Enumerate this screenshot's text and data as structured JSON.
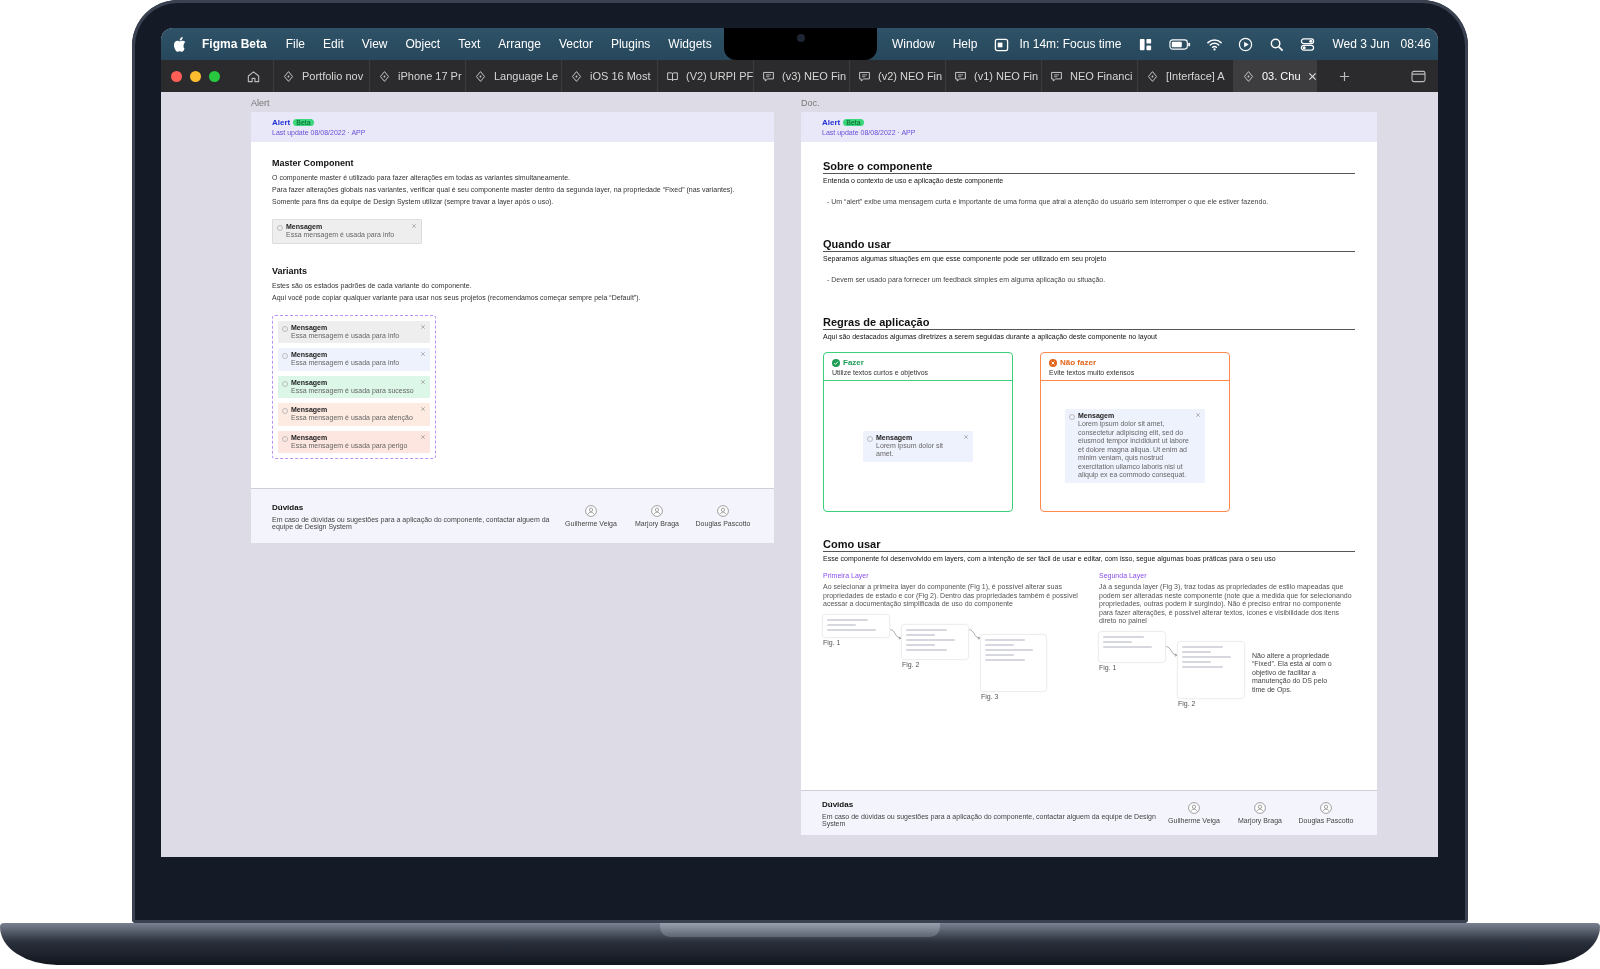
{
  "menu_bar": {
    "app": "Figma Beta",
    "menus_left": [
      "File",
      "Edit",
      "View",
      "Object",
      "Text",
      "Arrange",
      "Vector",
      "Plugins",
      "Widgets"
    ],
    "menus_right": [
      "Window",
      "Help"
    ],
    "focus": "In 14m: Focus time",
    "date": "Wed 3 Jun",
    "time": "08:46"
  },
  "tabs": [
    {
      "label": "Portfolio nov",
      "kind": "design",
      "selected": false
    },
    {
      "label": "iPhone 17 Pr",
      "kind": "design",
      "selected": false
    },
    {
      "label": "Language Le",
      "kind": "design",
      "selected": false
    },
    {
      "label": "iOS 16 Most",
      "kind": "design",
      "selected": false
    },
    {
      "label": "(V2) URPI PF",
      "kind": "slides",
      "selected": false
    },
    {
      "label": "(v3) NEO Fin",
      "kind": "board",
      "selected": false
    },
    {
      "label": "(v2) NEO Fin",
      "kind": "board",
      "selected": false
    },
    {
      "label": "(v1) NEO Fin",
      "kind": "board",
      "selected": false
    },
    {
      "label": "NEO Financi",
      "kind": "board",
      "selected": false
    },
    {
      "label": "[Interface] A",
      "kind": "design",
      "selected": false
    },
    {
      "label": "03. Chu",
      "kind": "design",
      "selected": true
    }
  ],
  "left_frame": {
    "label": "Alert",
    "header": {
      "title": "Alert",
      "badge": "Beta",
      "subtitle": "Last update 08/08/2022 · APP"
    },
    "master": {
      "title": "Master Component",
      "paragraphs": [
        "O componente master é utilizado para fazer alterações em todas as variantes simultaneamente.",
        "Para fazer alterações globais nas variantes, verificar qual é seu componente master dentro da segunda layer, na propriedade  “Fixed” (nas variantes).",
        "Somente para fins da equipe de Design System utilizar (sempre travar a layer após o uso)."
      ],
      "alert": {
        "title": "Mensagem",
        "text": "Essa mensagem é usada para info",
        "color": "#eeeeee"
      }
    },
    "variants": {
      "title": "Variants",
      "paragraphs": [
        "Estes são os estados padrões de cada variante do componente.",
        "Aqui você pode copiar qualquer variante para usar nos seus projetos (recomendamos começar sempre pela “Default”)."
      ],
      "alerts": [
        {
          "title": "Mensagem",
          "text": "Essa mensagem é usada para info",
          "color": "#eeeeee"
        },
        {
          "title": "Mensagem",
          "text": "Essa mensagem é usada para info",
          "color": "#eef2fd"
        },
        {
          "title": "Mensagem",
          "text": "Essa mensagem é usada para sucesso",
          "color": "#dcf7e8"
        },
        {
          "title": "Mensagem",
          "text": "Essa mensagem é usada para atenção",
          "color": "#fdebe2"
        },
        {
          "title": "Mensagem",
          "text": "Essa mensagem é usada para perigo",
          "color": "#fde6df"
        }
      ]
    },
    "footer": {
      "title": "Dúvidas",
      "text": "Em caso de dúvidas ou sugestões para a aplicação do componente, contactar alguem da equipe de Design System",
      "people": [
        "Guilherme Veiga",
        "Marjory Braga",
        "Douglas Pascotto"
      ]
    }
  },
  "right_frame": {
    "label": "Doc.",
    "header": {
      "title": "Alert",
      "badge": "Beta",
      "subtitle": "Last update 08/08/2022 · APP"
    },
    "sections": [
      {
        "title": "Sobre o componente",
        "subtitle": "Entenda o contexto de uso e aplicação deste componente",
        "bullet": "- Um “alert” exibe uma mensagem curta e importante de uma forma que atrai a atenção do usuário sem interromper o que ele estiver fazendo."
      },
      {
        "title": "Quando usar",
        "subtitle": "Separamos algumas situações em que esse componente pode ser utilizado em seu projeto",
        "bullet": "- Devem ser usado para fornecer um feedback simples em alguma aplicação ou situação."
      }
    ],
    "rules": {
      "title": "Regras de aplicação",
      "subtitle": "Aqui são destacados algumas diretrizes a serem seguidas durante a aplicação deste componente no layout",
      "cards": [
        {
          "kind": "do",
          "title": "Fazer",
          "subtitle": "Utilize textos curtos e objetivos",
          "alert_title": "Mensagem",
          "alert_text": "Lorem ipsum dolor sit amet."
        },
        {
          "kind": "dont",
          "title": "Não fazer",
          "subtitle": "Evite textos muito extensos",
          "alert_title": "Mensagem",
          "alert_text": "Lorem ipsum dolor sit amet, consectetur adipiscing elit, sed do eiusmod tempor incididunt ut labore et dolore magna aliqua. Ut enim ad minim veniam, quis nostrud exercitation ullamco laboris nisi ut aliquip ex ea commodo consequat."
        }
      ]
    },
    "usage": {
      "title": "Como usar",
      "subtitle": "Esse componente foi desenvolvido em layers, com a intenção de ser fácil de usar e editar, com isso, segue algumas boas práticas para o seu uso",
      "columns": [
        {
          "title": "Primeira Layer",
          "text": "Ao selecionar a primeira layer do componente (Fig 1), é possível alterar suas propriedades de estado e cor (Fig 2). Dentro das propriedades também é possível acessar a documentação simplificada de uso do componente",
          "figures": [
            "Fig. 1",
            "Fig. 2",
            "Fig. 3"
          ]
        },
        {
          "title": "Segunda Layer",
          "text": "Já a segunda layer (Fig 3), traz todas as propriedades de estilo mapeadas que podem ser alteradas neste componente (note que a medida que for selecionando propriedades, outras podem ir surgindo). Não é preciso entrar no componente para fazer alterações, é possível alterar textos, ícones e visibilidade dos itens direto no painel",
          "figures": [
            "Fig. 1",
            "Fig. 2"
          ],
          "note": "Não altere a propriedade “Fixed”. Ela está aí com o objetivo de facilitar a manutenção do DS pelo time de Ops."
        }
      ]
    },
    "footer": {
      "title": "Dúvidas",
      "text": "Em caso de dúvidas ou sugestões para a aplicação do componente, contactar alguem da equipe de Design System",
      "people": [
        "Guilherme Veiga",
        "Marjory Braga",
        "Douglas Pascotto"
      ]
    }
  }
}
